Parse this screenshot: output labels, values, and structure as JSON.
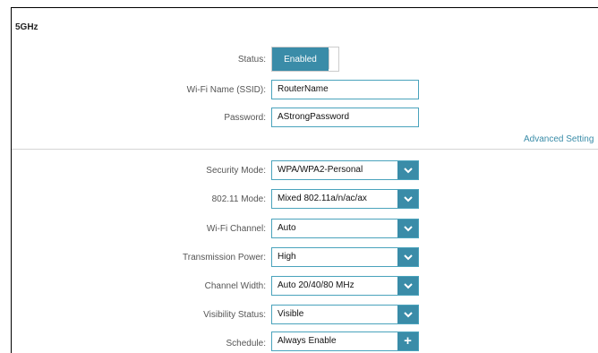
{
  "section": {
    "title": "5GHz"
  },
  "status": {
    "label": "Status:",
    "value": "Enabled",
    "enabled": true
  },
  "ssid": {
    "label": "Wi-Fi Name (SSID):",
    "value": "RouterName"
  },
  "password": {
    "label": "Password:",
    "value": "AStrongPassword"
  },
  "advanced_link": "Advanced Setting",
  "settings": {
    "security_mode": {
      "label": "Security Mode:",
      "value": "WPA/WPA2-Personal"
    },
    "mode_80211": {
      "label": "802.11 Mode:",
      "value": "Mixed 802.11a/n/ac/ax"
    },
    "channel": {
      "label": "Wi-Fi Channel:",
      "value": "Auto"
    },
    "tx_power": {
      "label": "Transmission Power:",
      "value": "High"
    },
    "channel_width": {
      "label": "Channel Width:",
      "value": "Auto 20/40/80 MHz"
    },
    "visibility": {
      "label": "Visibility Status:",
      "value": "Visible"
    },
    "schedule": {
      "label": "Schedule:",
      "value": "Always Enable"
    }
  },
  "icons": {
    "dropdown": "chevron-down-icon",
    "add": "plus-icon"
  },
  "colors": {
    "accent": "#3a8ca8",
    "field_border": "#4aa3bc",
    "link": "#3a8ca8"
  }
}
